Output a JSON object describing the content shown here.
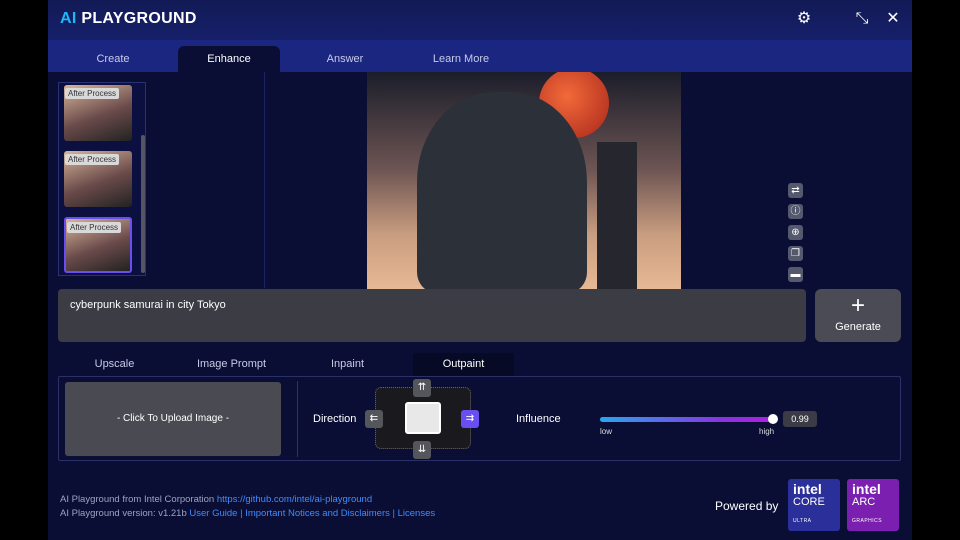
{
  "header": {
    "logo_ai": "AI",
    "logo_rest": "PLAYGROUND",
    "settings_icon": "gear-icon",
    "minimize_icon": "minimize-icon",
    "close_icon": "close-icon"
  },
  "tabs": [
    {
      "label": "Create"
    },
    {
      "label": "Enhance",
      "active": true
    },
    {
      "label": "Answer"
    },
    {
      "label": "Learn More"
    }
  ],
  "history": [
    {
      "badge": "After Process"
    },
    {
      "badge": "After Process"
    },
    {
      "badge": "After Process",
      "selected": true
    }
  ],
  "prompt": {
    "value": "cyberpunk samurai in city Tokyo"
  },
  "generate": {
    "label": "Generate",
    "icon": "plus-icon"
  },
  "sub_tabs": [
    {
      "label": "Upscale"
    },
    {
      "label": "Image Prompt"
    },
    {
      "label": "Inpaint"
    },
    {
      "label": "Outpaint",
      "active": true
    }
  ],
  "outpaint": {
    "upload_label": "- Click To Upload Image -",
    "direction_label": "Direction",
    "selected_direction": "right",
    "influence_label": "Influence",
    "influence_value": "0.99",
    "influence_fraction": 0.99,
    "low_label": "low",
    "high_label": "high"
  },
  "footer": {
    "line1_text": "AI Playground from Intel Corporation",
    "line1_link": "https://github.com/intel/ai-playground",
    "line2_text": "AI Playground version: v1.21b",
    "links": [
      "User Guide",
      "Important Notices and Disclaimers",
      "Licenses"
    ],
    "separator": "|",
    "powered_by": "Powered by"
  },
  "brands": [
    {
      "name": "intel",
      "product": "CORE",
      "sub": "ULTRA",
      "color": "#2a2f9a"
    },
    {
      "name": "intel",
      "product": "ARC",
      "sub": "GRAPHICS",
      "color": "#7a1fb0"
    }
  ]
}
